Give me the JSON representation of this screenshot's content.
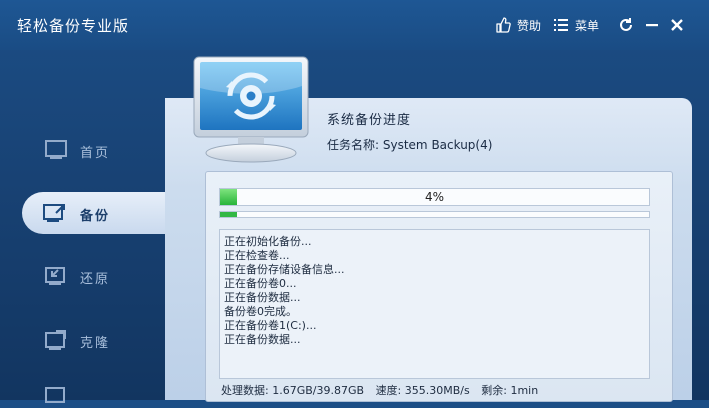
{
  "app": {
    "title": "轻松备份专业版"
  },
  "titlebar": {
    "donate_label": "赞助",
    "menu_label": "菜单",
    "donate_icon": "thumbs-up-icon",
    "menu_icon": "menu-icon",
    "refresh_icon": "refresh-icon",
    "minimize_icon": "minimize-icon",
    "close_icon": "close-icon"
  },
  "sidebar": {
    "items": [
      {
        "label": "首页",
        "icon": "home-icon",
        "active": false
      },
      {
        "label": "备份",
        "icon": "backup-icon",
        "active": true
      },
      {
        "label": "还原",
        "icon": "restore-icon",
        "active": false
      },
      {
        "label": "克隆",
        "icon": "clone-icon",
        "active": false
      }
    ]
  },
  "task": {
    "heading": "系统备份进度",
    "name_label": "任务名称:",
    "name_value": "System Backup(4)"
  },
  "progress": {
    "percent_text": "4%",
    "percent": 4,
    "sub_percent": 4
  },
  "log": {
    "lines": [
      "正在初始化备份...",
      "正在检查卷...",
      "正在备份存储设备信息...",
      "正在备份卷0...",
      "正在备份数据...",
      "备份卷0完成。",
      "正在备份卷1(C:)...",
      "正在备份数据..."
    ]
  },
  "stats": {
    "processed_label": "处理数据:",
    "processed_value": "1.67GB/39.87GB",
    "speed_label": "速度:",
    "speed_value": "355.30MB/s",
    "remaining_label": "剩余:",
    "remaining_value": "1min"
  },
  "colors": {
    "background": "#184274",
    "panel": "#d6e3f2",
    "progress_green": "#28b43a"
  }
}
